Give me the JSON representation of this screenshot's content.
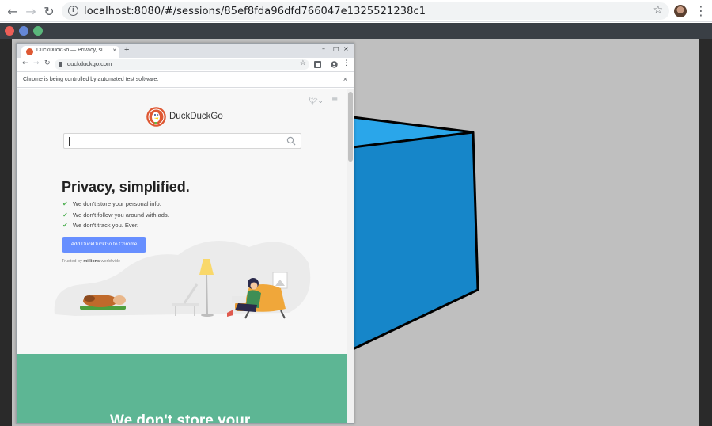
{
  "outer_browser": {
    "url": "localhost:8080/#/sessions/85ef8fda96dfd766047e1325521238c1",
    "icons": [
      "back-icon",
      "forward-icon",
      "reload-icon",
      "info-icon",
      "bookmark-star-icon",
      "profile-avatar",
      "menu-kebab-icon"
    ]
  },
  "window_dots": {
    "colors": [
      "#ec5e57",
      "#6487d6",
      "#5ab67b"
    ]
  },
  "inner_browser": {
    "tab_title": "DuckDuckGo — Privacy, si",
    "tab_close": "×",
    "new_tab": "+",
    "window_controls": [
      "–",
      "□",
      "×"
    ],
    "url": "duckduckgo.com",
    "infobar_message": "Chrome is being controlled by automated test software.",
    "infobar_close": "×"
  },
  "page": {
    "brand": "DuckDuckGo",
    "search_placeholder": "",
    "headline": "Privacy, simplified.",
    "bullets": [
      "We don't store your personal info.",
      "We don't follow you around with ads.",
      "We don't track you. Ever."
    ],
    "check_glyph": "✔",
    "cta_label": "Add DuckDuckGo to Chrome",
    "trusted_prefix": "Trusted by",
    "trusted_bold": "millions",
    "trusted_suffix": "worldwide",
    "green_heading": "We don't store your"
  },
  "colors": {
    "accent_button": "#678fff",
    "green_section": "#5db694",
    "cube_front": "#1686c9",
    "cube_top": "#2aa6ea",
    "canvas_bg": "#bfbfbf"
  }
}
